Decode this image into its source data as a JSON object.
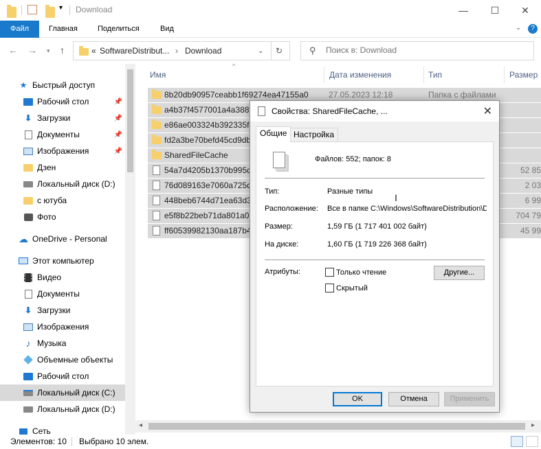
{
  "window": {
    "title": "Download"
  },
  "ribbon": {
    "tabs": [
      "Файл",
      "Главная",
      "Поделиться",
      "Вид"
    ]
  },
  "address": {
    "prefix": "«",
    "segment1": "SoftwareDistribut...",
    "segment2": "Download"
  },
  "search": {
    "placeholder": "Поиск в: Download"
  },
  "sidebar": {
    "items": [
      {
        "label": "Быстрый доступ",
        "icon": "star-icon"
      },
      {
        "label": "Рабочий стол",
        "icon": "desktop-icon"
      },
      {
        "label": "Загрузки",
        "icon": "download-icon"
      },
      {
        "label": "Документы",
        "icon": "documents-icon"
      },
      {
        "label": "Изображения",
        "icon": "pictures-icon"
      },
      {
        "label": "Дзен",
        "icon": "folder-icon"
      },
      {
        "label": "Локальный диск (D:)",
        "icon": "drive-icon"
      },
      {
        "label": "с ютуба",
        "icon": "folder-icon"
      },
      {
        "label": "Фото",
        "icon": "camera-icon"
      },
      {
        "label": "OneDrive - Personal",
        "icon": "cloud-icon"
      },
      {
        "label": "Этот компьютер",
        "icon": "computer-icon"
      },
      {
        "label": "Видео",
        "icon": "video-icon"
      },
      {
        "label": "Документы",
        "icon": "documents-icon"
      },
      {
        "label": "Загрузки",
        "icon": "download-icon"
      },
      {
        "label": "Изображения",
        "icon": "pictures-icon"
      },
      {
        "label": "Музыка",
        "icon": "music-icon"
      },
      {
        "label": "Объемные объекты",
        "icon": "3d-objects-icon"
      },
      {
        "label": "Рабочий стол",
        "icon": "desktop-icon"
      },
      {
        "label": "Локальный диск (C:)",
        "icon": "drive-icon"
      },
      {
        "label": "Локальный диск (D:)",
        "icon": "drive-icon"
      },
      {
        "label": "Сеть",
        "icon": "network-icon"
      }
    ]
  },
  "columns": {
    "name": "Имя",
    "date": "Дата изменения",
    "type": "Тип",
    "size": "Размер"
  },
  "files": [
    {
      "name": "8b20db90957ceabb1f69274ea47155a0",
      "date": "27.05.2023 12:18",
      "type": "Папка с файлами",
      "size": "",
      "kind": "folder"
    },
    {
      "name": "a4b37f4577001a4a388fd",
      "date": "",
      "type": "",
      "size": "",
      "kind": "folder"
    },
    {
      "name": "e86ae003324b392335f4c",
      "date": "",
      "type": "",
      "size": "",
      "kind": "folder"
    },
    {
      "name": "fd2a3be70befd45cd9db",
      "date": "",
      "type": "",
      "size": "",
      "kind": "folder"
    },
    {
      "name": "SharedFileCache",
      "date": "",
      "type": "",
      "size": "",
      "kind": "folder"
    },
    {
      "name": "54a7d4205b1370b995d3",
      "date": "",
      "type": "",
      "size": "52 85",
      "kind": "file"
    },
    {
      "name": "76d089163e7060a725d5",
      "date": "",
      "type": "",
      "size": "2 03",
      "kind": "file"
    },
    {
      "name": "448beb6744d71ea63d3ac",
      "date": "",
      "type": "",
      "size": "6 99",
      "kind": "file"
    },
    {
      "name": "e5f8b22beb71da801a021",
      "date": "",
      "type": "",
      "size": "704 79",
      "kind": "file"
    },
    {
      "name": "ff60539982130aa187b4b",
      "date": "",
      "type": "",
      "size": "45 99",
      "kind": "file"
    }
  ],
  "status": {
    "count": "Элементов: 10",
    "selected": "Выбрано 10 элем."
  },
  "dialog": {
    "title": "Свойства: SharedFileCache, ...",
    "tabs": [
      "Общие",
      "Настройка"
    ],
    "summary": "Файлов: 552; папок: 8",
    "type_label": "Тип:",
    "type_value": "Разные типы",
    "location_label": "Расположение:",
    "location_value": "Все в папке C:\\Windows\\SoftwareDistribution\\D",
    "size_label": "Размер:",
    "size_value": "1,59 ГБ (1 717 401 002 байт)",
    "disk_label": "На диске:",
    "disk_value": "1,60 ГБ (1 719 226 368 байт)",
    "attr_label": "Атрибуты:",
    "readonly_label": "Только чтение",
    "hidden_label": "Скрытый",
    "other_button": "Другие...",
    "ok": "OK",
    "cancel": "Отмена",
    "apply": "Применить"
  }
}
